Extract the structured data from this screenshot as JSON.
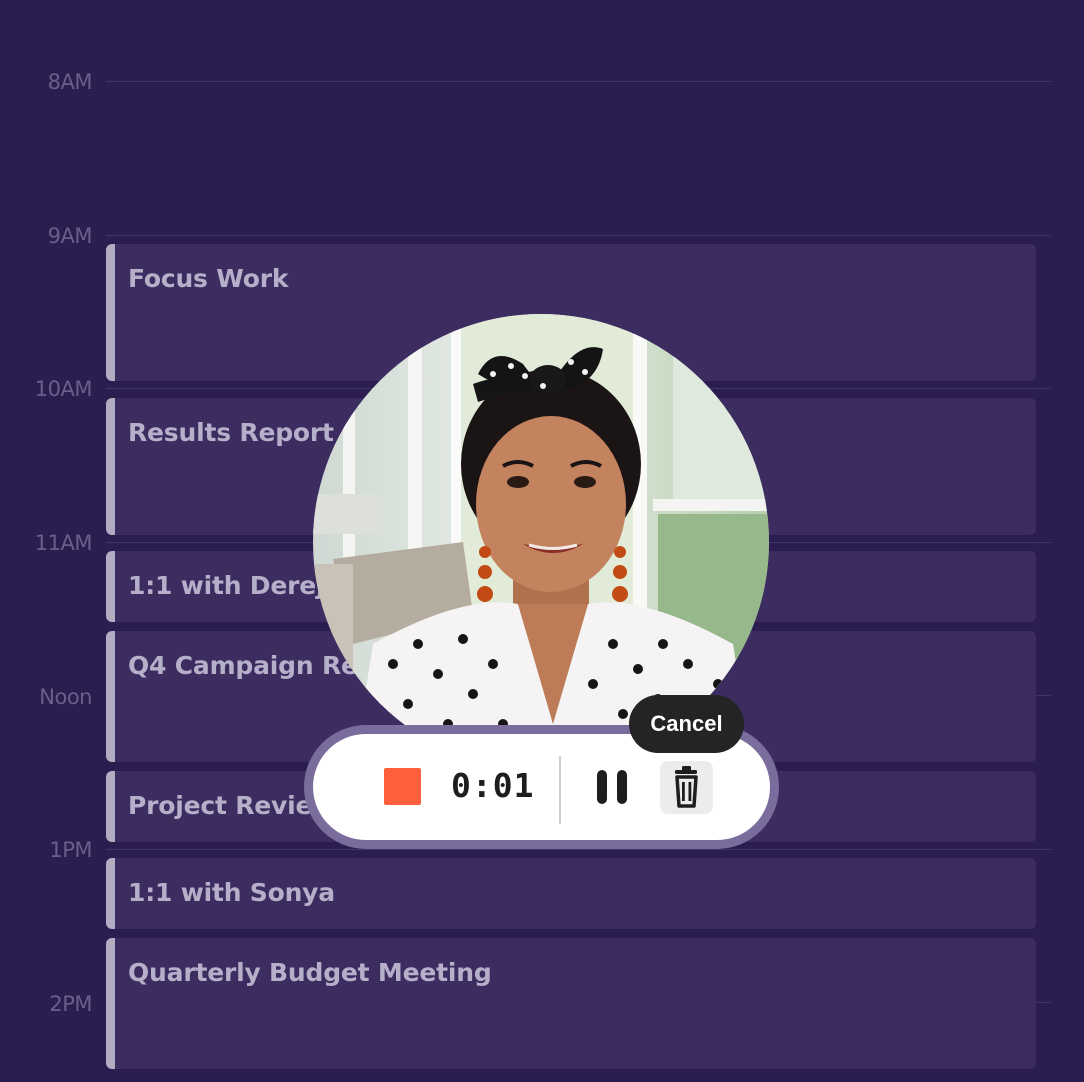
{
  "calendar": {
    "time_labels": [
      "8AM",
      "9AM",
      "10AM",
      "11AM",
      "Noon",
      "1PM",
      "2PM"
    ],
    "events": [
      {
        "title": "Focus Work"
      },
      {
        "title": "Results Report"
      },
      {
        "title": "1:1 with Dereje"
      },
      {
        "title": "Q4 Campaign Results"
      },
      {
        "title": "Project Review"
      },
      {
        "title": "1:1 with Sonya"
      },
      {
        "title": "Quarterly Budget Meeting"
      }
    ]
  },
  "recorder": {
    "elapsed": "0:01",
    "cancel_label": "Cancel",
    "colors": {
      "stop": "#ff5f3a",
      "panel": "#ffffff",
      "ring": "#7a6c9c",
      "tooltip": "#242424"
    }
  },
  "icons": {
    "stop": "stop-icon",
    "pause": "pause-icon",
    "trash": "trash-icon"
  },
  "theme": {
    "background": "#2b1d50",
    "event_fill": "#3c2c60",
    "event_accent": "#b2acc2"
  }
}
